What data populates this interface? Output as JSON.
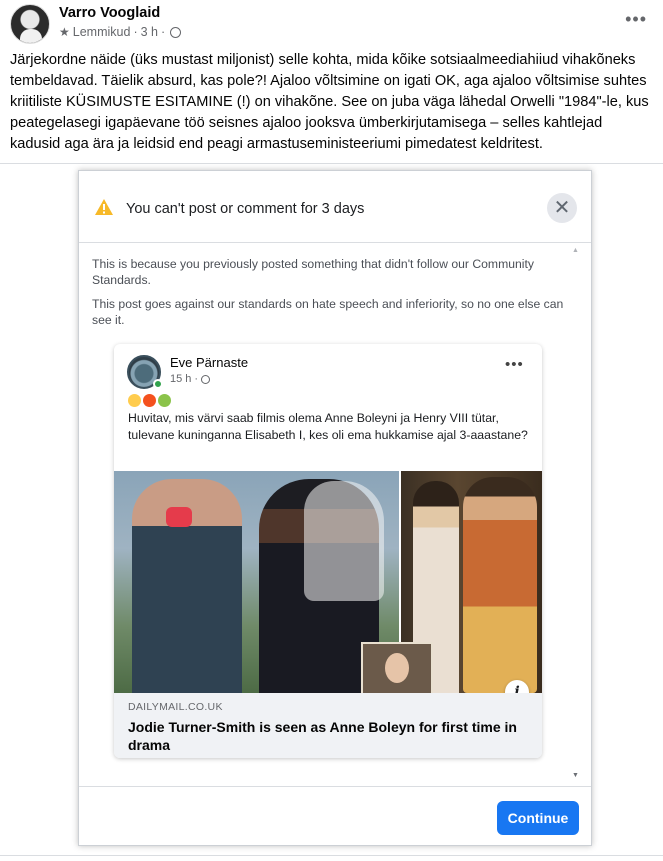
{
  "post": {
    "author": "Varro Vooglaid",
    "audience": "Lemmikud",
    "time": "3 h",
    "separator": "·",
    "text": "Järjekordne näide (üks mustast miljonist) selle kohta, mida kõike sotsiaalmeediahiiud vihakõneks tembeldavad. Täielik absurd, kas pole?! Ajaloo võltsimine on igati OK, aga ajaloo võltsimise suhtes kriitiliste KÜSIMUSTE ESITAMINE (!) on vihakõne. See on juba väga lähedal Orwelli \"1984\"-le, kus peategelasegi igapäevane töö seisnes ajaloo jooksva ümberkirjutamisega – selles kahtlejad kadusid aga ära ja leidsid end peagi armastuseministeeriumi pimedatest keldritest."
  },
  "dialog": {
    "title": "You can't post or comment for 3 days",
    "paragraph1": "This is because you previously posted something that didn't follow our Community Standards.",
    "paragraph2": "This post goes against our standards on hate speech and inferiority, so no one else can see it.",
    "continue_label": "Continue"
  },
  "embedded_post": {
    "author": "Eve Pärnaste",
    "time": "15 h",
    "separator": "·",
    "emojis": [
      "face-screaming-emoji",
      "angry-face-emoji",
      "nauseated-face-emoji"
    ],
    "text": "Huvitav, mis värvi saab filmis olema Anne Boleyni ja Henry VIII tütar, tulevane kuninganna Elisabeth I, kes oli ema hukkamise ajal 3-aaastane?",
    "link_domain": "DAILYMAIL.CO.UK",
    "link_title": "Jodie Turner-Smith is seen as Anne Boleyn for first time in drama"
  },
  "colors": {
    "accent": "#1877f2",
    "warning": "#f7b928",
    "online": "#31a24c",
    "mask": "#e53b4b"
  }
}
